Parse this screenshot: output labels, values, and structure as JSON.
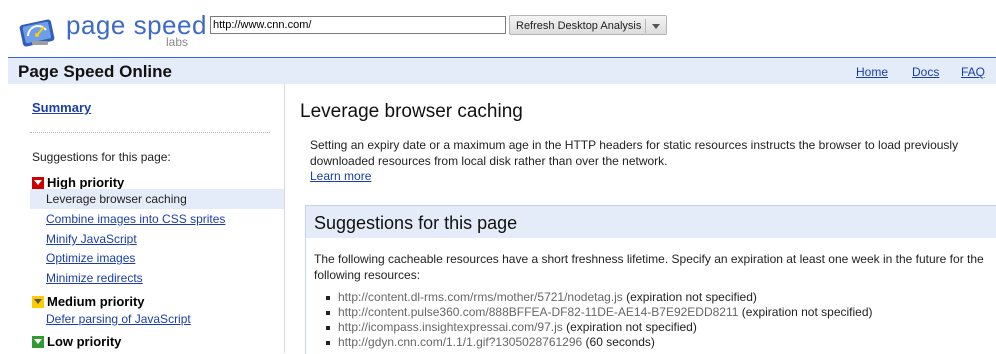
{
  "header": {
    "logo_text": "page speed",
    "logo_sub": "labs",
    "url_value": "http://www.cnn.com/",
    "analyze_button": "Refresh Desktop Analysis"
  },
  "titlebar": {
    "title": "Page Speed Online",
    "links": [
      "Home",
      "Docs",
      "FAQ"
    ]
  },
  "sidebar": {
    "summary": "Summary",
    "heading": "Suggestions for this page:",
    "high_label": "High priority",
    "high_items": [
      "Leverage browser caching",
      "Combine images into CSS sprites",
      "Minify JavaScript",
      "Optimize images",
      "Minimize redirects"
    ],
    "medium_label": "Medium priority",
    "medium_items": [
      "Defer parsing of JavaScript"
    ],
    "low_label": "Low priority"
  },
  "main": {
    "title": "Leverage browser caching",
    "description": "Setting an expiry date or a maximum age in the HTTP headers for static resources instructs the browser to load previously downloaded resources from local disk rather than over the network.",
    "learn_more": "Learn more",
    "suggestions_title": "Suggestions for this page",
    "suggestions_text": "The following cacheable resources have a short freshness lifetime. Specify an expiration at least one week in the future for the following resources:",
    "resources": [
      {
        "url": "http://content.dl-rms.com/rms/mother/5721/nodetag.js",
        "note": " (expiration not specified)"
      },
      {
        "url": "http://content.pulse360.com/888BFFEA-DF82-11DE-AE14-B7E92EDD8211",
        "note": " (expiration not specified)"
      },
      {
        "url": "http://icompass.insightexpressai.com/97.js",
        "note": " (expiration not specified)"
      },
      {
        "url": "http://gdyn.cnn.com/1.1/1.gif?1305028761296",
        "note": " (60 seconds)"
      }
    ]
  },
  "colors": {
    "accent": "#3366cc",
    "link": "#1a3ea8",
    "titlebar_bg": "#e5ecf9",
    "high_priority": "#cc0000",
    "medium_priority": "#ffcc00",
    "low_priority": "#339933"
  },
  "icons": {
    "logo": "speedometer-icon",
    "high": "red-caret-icon",
    "medium": "yellow-caret-icon",
    "low": "green-caret-icon"
  }
}
